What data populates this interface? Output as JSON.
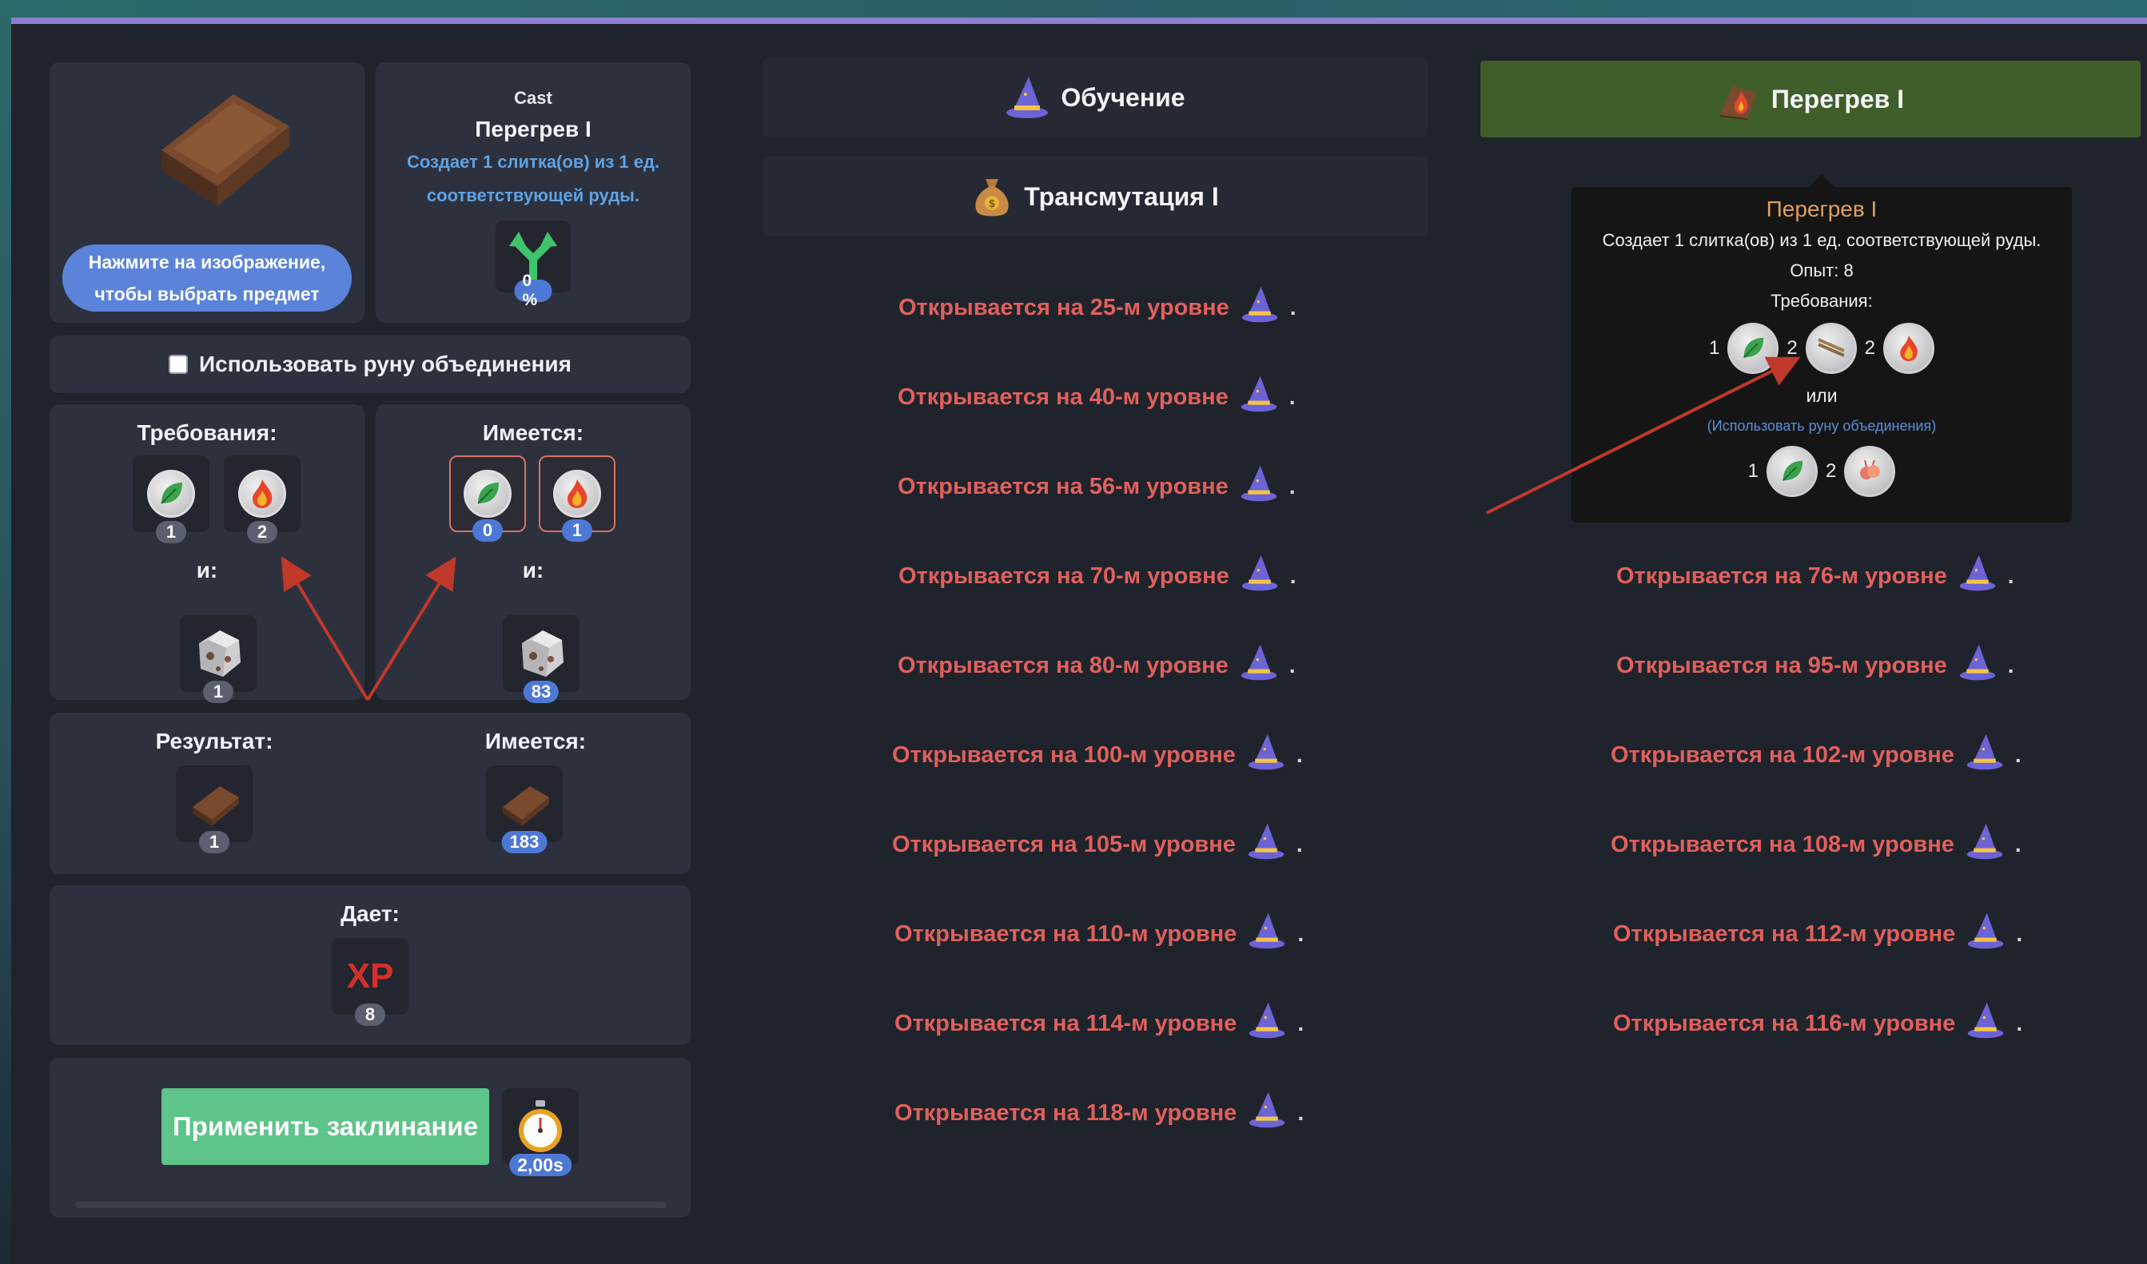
{
  "item_panel": {
    "select_button_label": "Нажмите на изображение, чтобы выбрать предмет"
  },
  "spell_info": {
    "category": "Cast",
    "name": "Перегрев I",
    "description": "Создает 1 слитка(ов) из 1 ед. соответствующей руды.",
    "progress_percent": "0 %"
  },
  "rune_option": {
    "label": "Использовать руну объединения",
    "checked": false
  },
  "requirements": {
    "title": "Требования:",
    "and_label": "и:",
    "items": [
      {
        "icon": "leaf-icon",
        "count": "1"
      },
      {
        "icon": "fire-icon",
        "count": "2"
      }
    ],
    "ore": {
      "icon": "ore-icon",
      "count": "1"
    }
  },
  "have": {
    "title": "Имеется:",
    "and_label": "и:",
    "items": [
      {
        "icon": "leaf-icon",
        "count": "0"
      },
      {
        "icon": "fire-icon",
        "count": "1"
      }
    ],
    "ore": {
      "icon": "ore-icon",
      "count": "83"
    }
  },
  "result": {
    "title": "Результат:",
    "count": "1",
    "have_title": "Имеется:",
    "have_count": "183"
  },
  "gives": {
    "title": "Дает:",
    "xp_label": "XP",
    "xp_value": "8"
  },
  "cast": {
    "button_label": "Применить заклинание",
    "time": "2,00s"
  },
  "tabs": {
    "learning": "Обучение",
    "transmutation": "Трансмутация I",
    "overheat": "Перегрев I"
  },
  "locked_left": [
    "Открывается на 25-м уровне",
    "Открывается на 40-м уровне",
    "Открывается на 56-м уровне",
    "Открывается на 70-м уровне",
    "Открывается на 80-м уровне",
    "Открывается на 100-м уровне",
    "Открывается на 105-м уровне",
    "Открывается на 110-м уровне",
    "Открывается на 114-м уровне",
    "Открывается на 118-м уровне"
  ],
  "locked_right": [
    "Открывается на 76-м уровне",
    "Открывается на 95-м уровне",
    "Открывается на 102-м уровне",
    "Открывается на 108-м уровне",
    "Открывается на 112-м уровне",
    "Открывается на 116-м уровне"
  ],
  "tooltip": {
    "title": "Перегрев I",
    "description": "Создает 1 слитка(ов) из 1 ед. соответствующей руды.",
    "xp": "Опыт: 8",
    "requirements_title": "Требования:",
    "req1": [
      {
        "count": "1",
        "icon": "leaf-icon"
      },
      {
        "count": "2",
        "icon": "sticks-icon"
      },
      {
        "count": "2",
        "icon": "fire-icon"
      }
    ],
    "or_label": "или",
    "rune_hint": "(Использовать руну объединения)",
    "req2": [
      {
        "count": "1",
        "icon": "leaf-icon"
      },
      {
        "count": "2",
        "icon": "rune-icon"
      }
    ]
  },
  "colors": {
    "accent_bar": "#8e7fd2",
    "locked_text": "#e0605c",
    "active_tab": "#3f5e2a",
    "cast_button": "#5ec489",
    "badge_blue": "#4d78d6",
    "arrow": "#c0392b"
  }
}
